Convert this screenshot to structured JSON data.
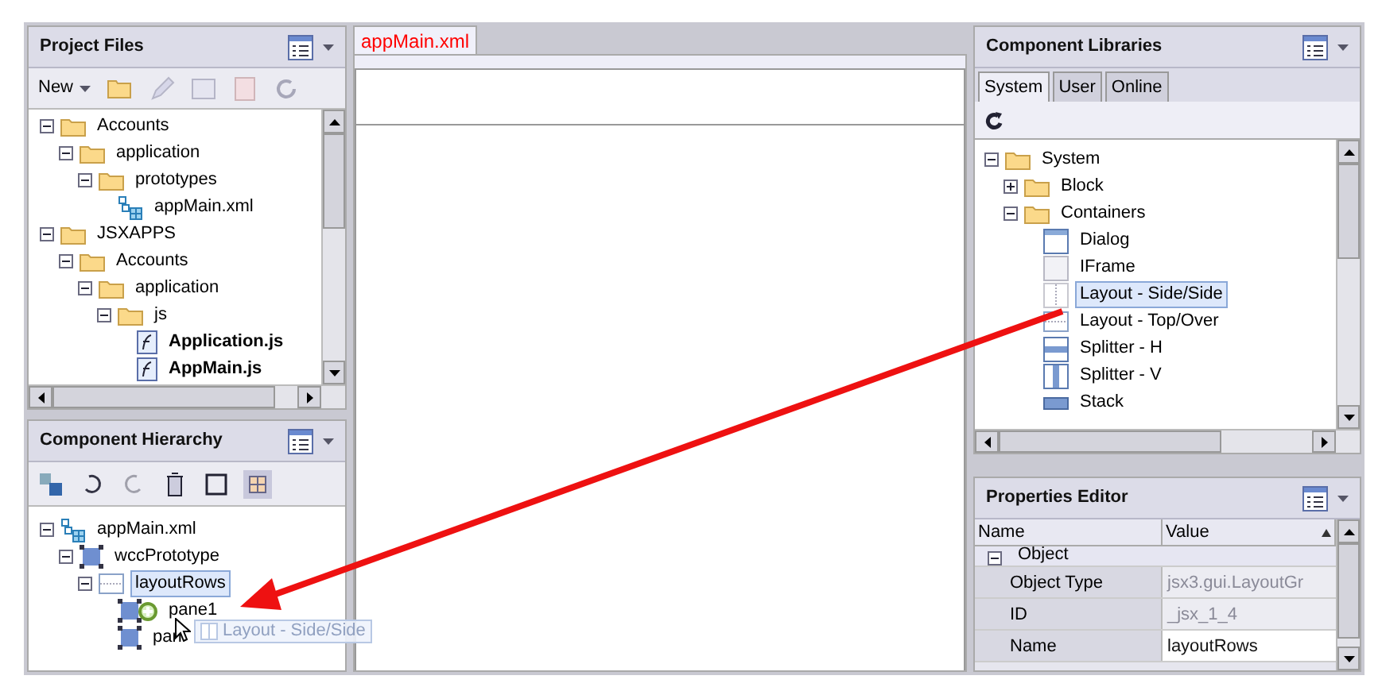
{
  "project_files": {
    "title": "Project Files",
    "new_button": "New",
    "tree": [
      {
        "label": "Accounts",
        "kind": "folder",
        "expanded": true,
        "children": [
          {
            "label": "application",
            "kind": "folder",
            "expanded": true,
            "children": [
              {
                "label": "prototypes",
                "kind": "folder",
                "expanded": true,
                "children": [
                  {
                    "label": "appMain.xml",
                    "kind": "xml"
                  }
                ]
              }
            ]
          }
        ]
      },
      {
        "label": "JSXAPPS",
        "kind": "folder",
        "expanded": true,
        "children": [
          {
            "label": "Accounts",
            "kind": "folder",
            "expanded": true,
            "children": [
              {
                "label": "application",
                "kind": "folder",
                "expanded": true,
                "children": [
                  {
                    "label": "js",
                    "kind": "folder",
                    "expanded": true,
                    "children": [
                      {
                        "label": "Application.js",
                        "kind": "js",
                        "bold": true
                      },
                      {
                        "label": "AppMain.js",
                        "kind": "js",
                        "bold": true
                      }
                    ]
                  }
                ]
              }
            ]
          }
        ]
      }
    ]
  },
  "component_hierarchy": {
    "title": "Component Hierarchy",
    "tree": [
      {
        "label": "appMain.xml",
        "kind": "xml",
        "expanded": true,
        "children": [
          {
            "label": "wccPrototype",
            "kind": "block",
            "expanded": true,
            "children": [
              {
                "label": "layoutRows",
                "kind": "layout-top",
                "expanded": true,
                "selected": true,
                "children": [
                  {
                    "label": "pane1",
                    "kind": "block",
                    "selected": false,
                    "drop_target": true
                  },
                  {
                    "label": "pan",
                    "kind": "block",
                    "selected": false
                  }
                ]
              }
            ]
          }
        ]
      }
    ],
    "drag_ghost": "Layout - Side/Side"
  },
  "editor": {
    "tabs": [
      {
        "label": "appMain.xml",
        "selected": true
      }
    ]
  },
  "component_libraries": {
    "title": "Component Libraries",
    "tabs": [
      {
        "label": "System",
        "selected": true
      },
      {
        "label": "User",
        "selected": false
      },
      {
        "label": "Online",
        "selected": false
      }
    ],
    "tree": [
      {
        "label": "System",
        "kind": "folder",
        "expanded": true,
        "children": [
          {
            "label": "Block",
            "kind": "folder",
            "expanded": false
          },
          {
            "label": "Containers",
            "kind": "folder",
            "expanded": true,
            "children": [
              {
                "label": "Dialog",
                "kind": "dialog",
                "selected": false
              },
              {
                "label": "IFrame",
                "kind": "iframe",
                "selected": false
              },
              {
                "label": "Layout - Side/Side",
                "kind": "layout-side",
                "selected": true
              },
              {
                "label": "Layout - Top/Over",
                "kind": "layout-top",
                "selected": false
              },
              {
                "label": "Splitter - H",
                "kind": "splitter-h",
                "selected": false
              },
              {
                "label": "Splitter - V",
                "kind": "splitter-v",
                "selected": false
              },
              {
                "label": "Stack",
                "kind": "stack",
                "selected": false
              }
            ]
          }
        ]
      }
    ]
  },
  "properties_editor": {
    "title": "Properties Editor",
    "columns": [
      "Name",
      "Value"
    ],
    "rows": [
      {
        "kind": "group",
        "name": "Object",
        "expanded": true
      },
      {
        "kind": "property",
        "name": "Object Type",
        "value": "jsx3.gui.LayoutGr",
        "editable": false
      },
      {
        "kind": "property",
        "name": "ID",
        "value": "_jsx_1_4",
        "editable": false
      },
      {
        "kind": "property",
        "name": "Name",
        "value": "layoutRows",
        "editable": true
      }
    ]
  }
}
